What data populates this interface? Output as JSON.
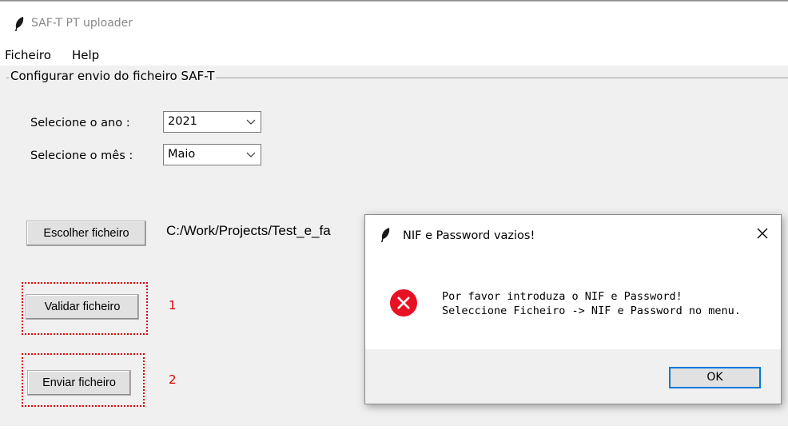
{
  "app": {
    "title": "SAF-T PT uploader"
  },
  "menu": {
    "items": [
      "Ficheiro",
      "Help"
    ]
  },
  "group": {
    "title": "Configurar envio do ficheiro SAF-T"
  },
  "form": {
    "year_label": "Selecione o ano :",
    "year_value": "2021",
    "month_label": "Selecione o mês :",
    "month_value": "Maio",
    "choose_file_label": "Escolher ficheiro",
    "file_path": "C:/Work/Projects/Test_e_fa",
    "validate_label": "Validar ficheiro",
    "send_label": "Enviar ficheiro"
  },
  "annotations": {
    "step1": "1",
    "step2": "2",
    "color": "#dd0000"
  },
  "dialog": {
    "title": "NIF e Password vazios!",
    "message_line1": "Por favor introduza o NIF e Password!",
    "message_line2": "Seleccione Ficheiro -> NIF e Password no menu.",
    "ok_label": "OK",
    "icon": "error-icon",
    "accent": "#0078d7"
  }
}
